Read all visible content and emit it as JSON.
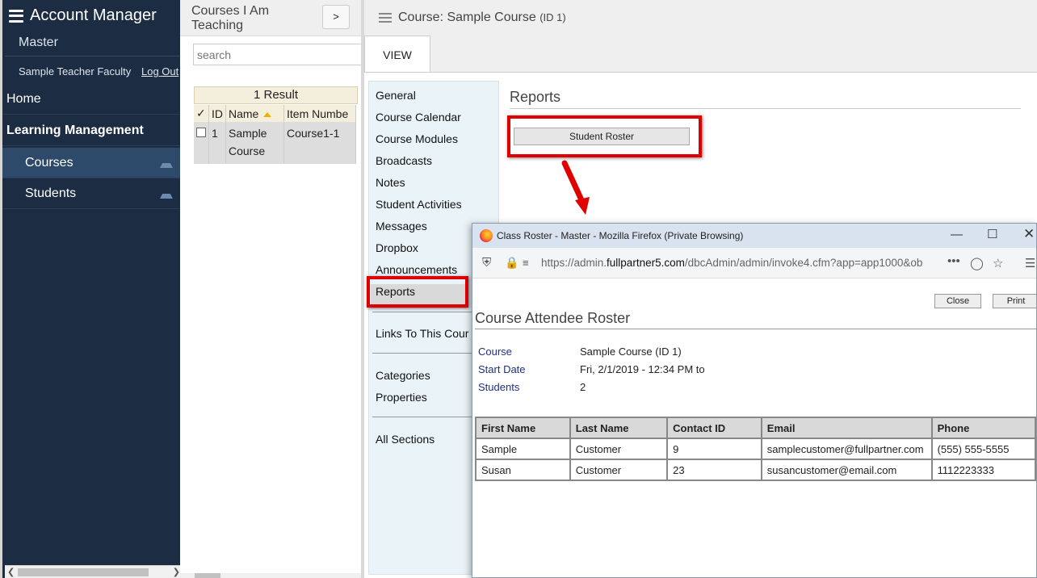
{
  "nav": {
    "app_title": "Account Manager",
    "org": "Master",
    "user": "Sample Teacher Faculty",
    "logout": "Log Out",
    "items": [
      {
        "label": "Home"
      },
      {
        "label": "Learning Management"
      },
      {
        "label": "Courses"
      },
      {
        "label": "Students"
      }
    ]
  },
  "list": {
    "header": "Courses I Am Teaching",
    "expand_label": ">",
    "search_placeholder": "search",
    "result_count": "1 Result",
    "columns": [
      "✓",
      "ID",
      "Name",
      "Item Numbe"
    ],
    "rows": [
      {
        "id": "1",
        "name": "Sample Course",
        "item_number": "Course1-1"
      }
    ]
  },
  "detail": {
    "title": "Course: Sample Course",
    "title_id": "(ID 1)",
    "tab": "VIEW",
    "menu": [
      "General",
      "Course Calendar",
      "Course Modules",
      "Broadcasts",
      "Notes",
      "Student Activities",
      "Messages",
      "Dropbox",
      "Announcements",
      "Reports",
      "Links To This Cour",
      "Categories",
      "Properties",
      "All Sections"
    ],
    "reports_heading": "Reports",
    "roster_button": "Student Roster"
  },
  "popup": {
    "window_title": "Class Roster - Master - Mozilla Firefox (Private Browsing)",
    "url_prefix": "https://admin.",
    "url_domain": "fullpartner5.com",
    "url_rest": "/dbcAdmin/admin/invoke4.cfm?app=app1000&ob",
    "close_label": "Close",
    "print_label": "Print",
    "report_title": "Course Attendee Roster",
    "info": [
      {
        "key": "Course",
        "value": "Sample Course (ID 1)"
      },
      {
        "key": "Start Date",
        "value": "Fri, 2/1/2019 - 12:34 PM to"
      },
      {
        "key": "Students",
        "value": "2"
      }
    ],
    "columns": [
      "First Name",
      "Last Name",
      "Contact ID",
      "Email",
      "Phone"
    ],
    "rows": [
      {
        "first": "Sample",
        "last": "Customer",
        "contact_id": "9",
        "email": "samplecustomer@fullpartner.com",
        "phone": "(555) 555-5555"
      },
      {
        "first": "Susan",
        "last": "Customer",
        "contact_id": "23",
        "email": "susancustomer@email.com",
        "phone": "1112223333"
      }
    ]
  },
  "colors": {
    "nav_bg": "#1c2c42",
    "nav_active": "#2e4a6b",
    "highlight": "#e00000"
  }
}
